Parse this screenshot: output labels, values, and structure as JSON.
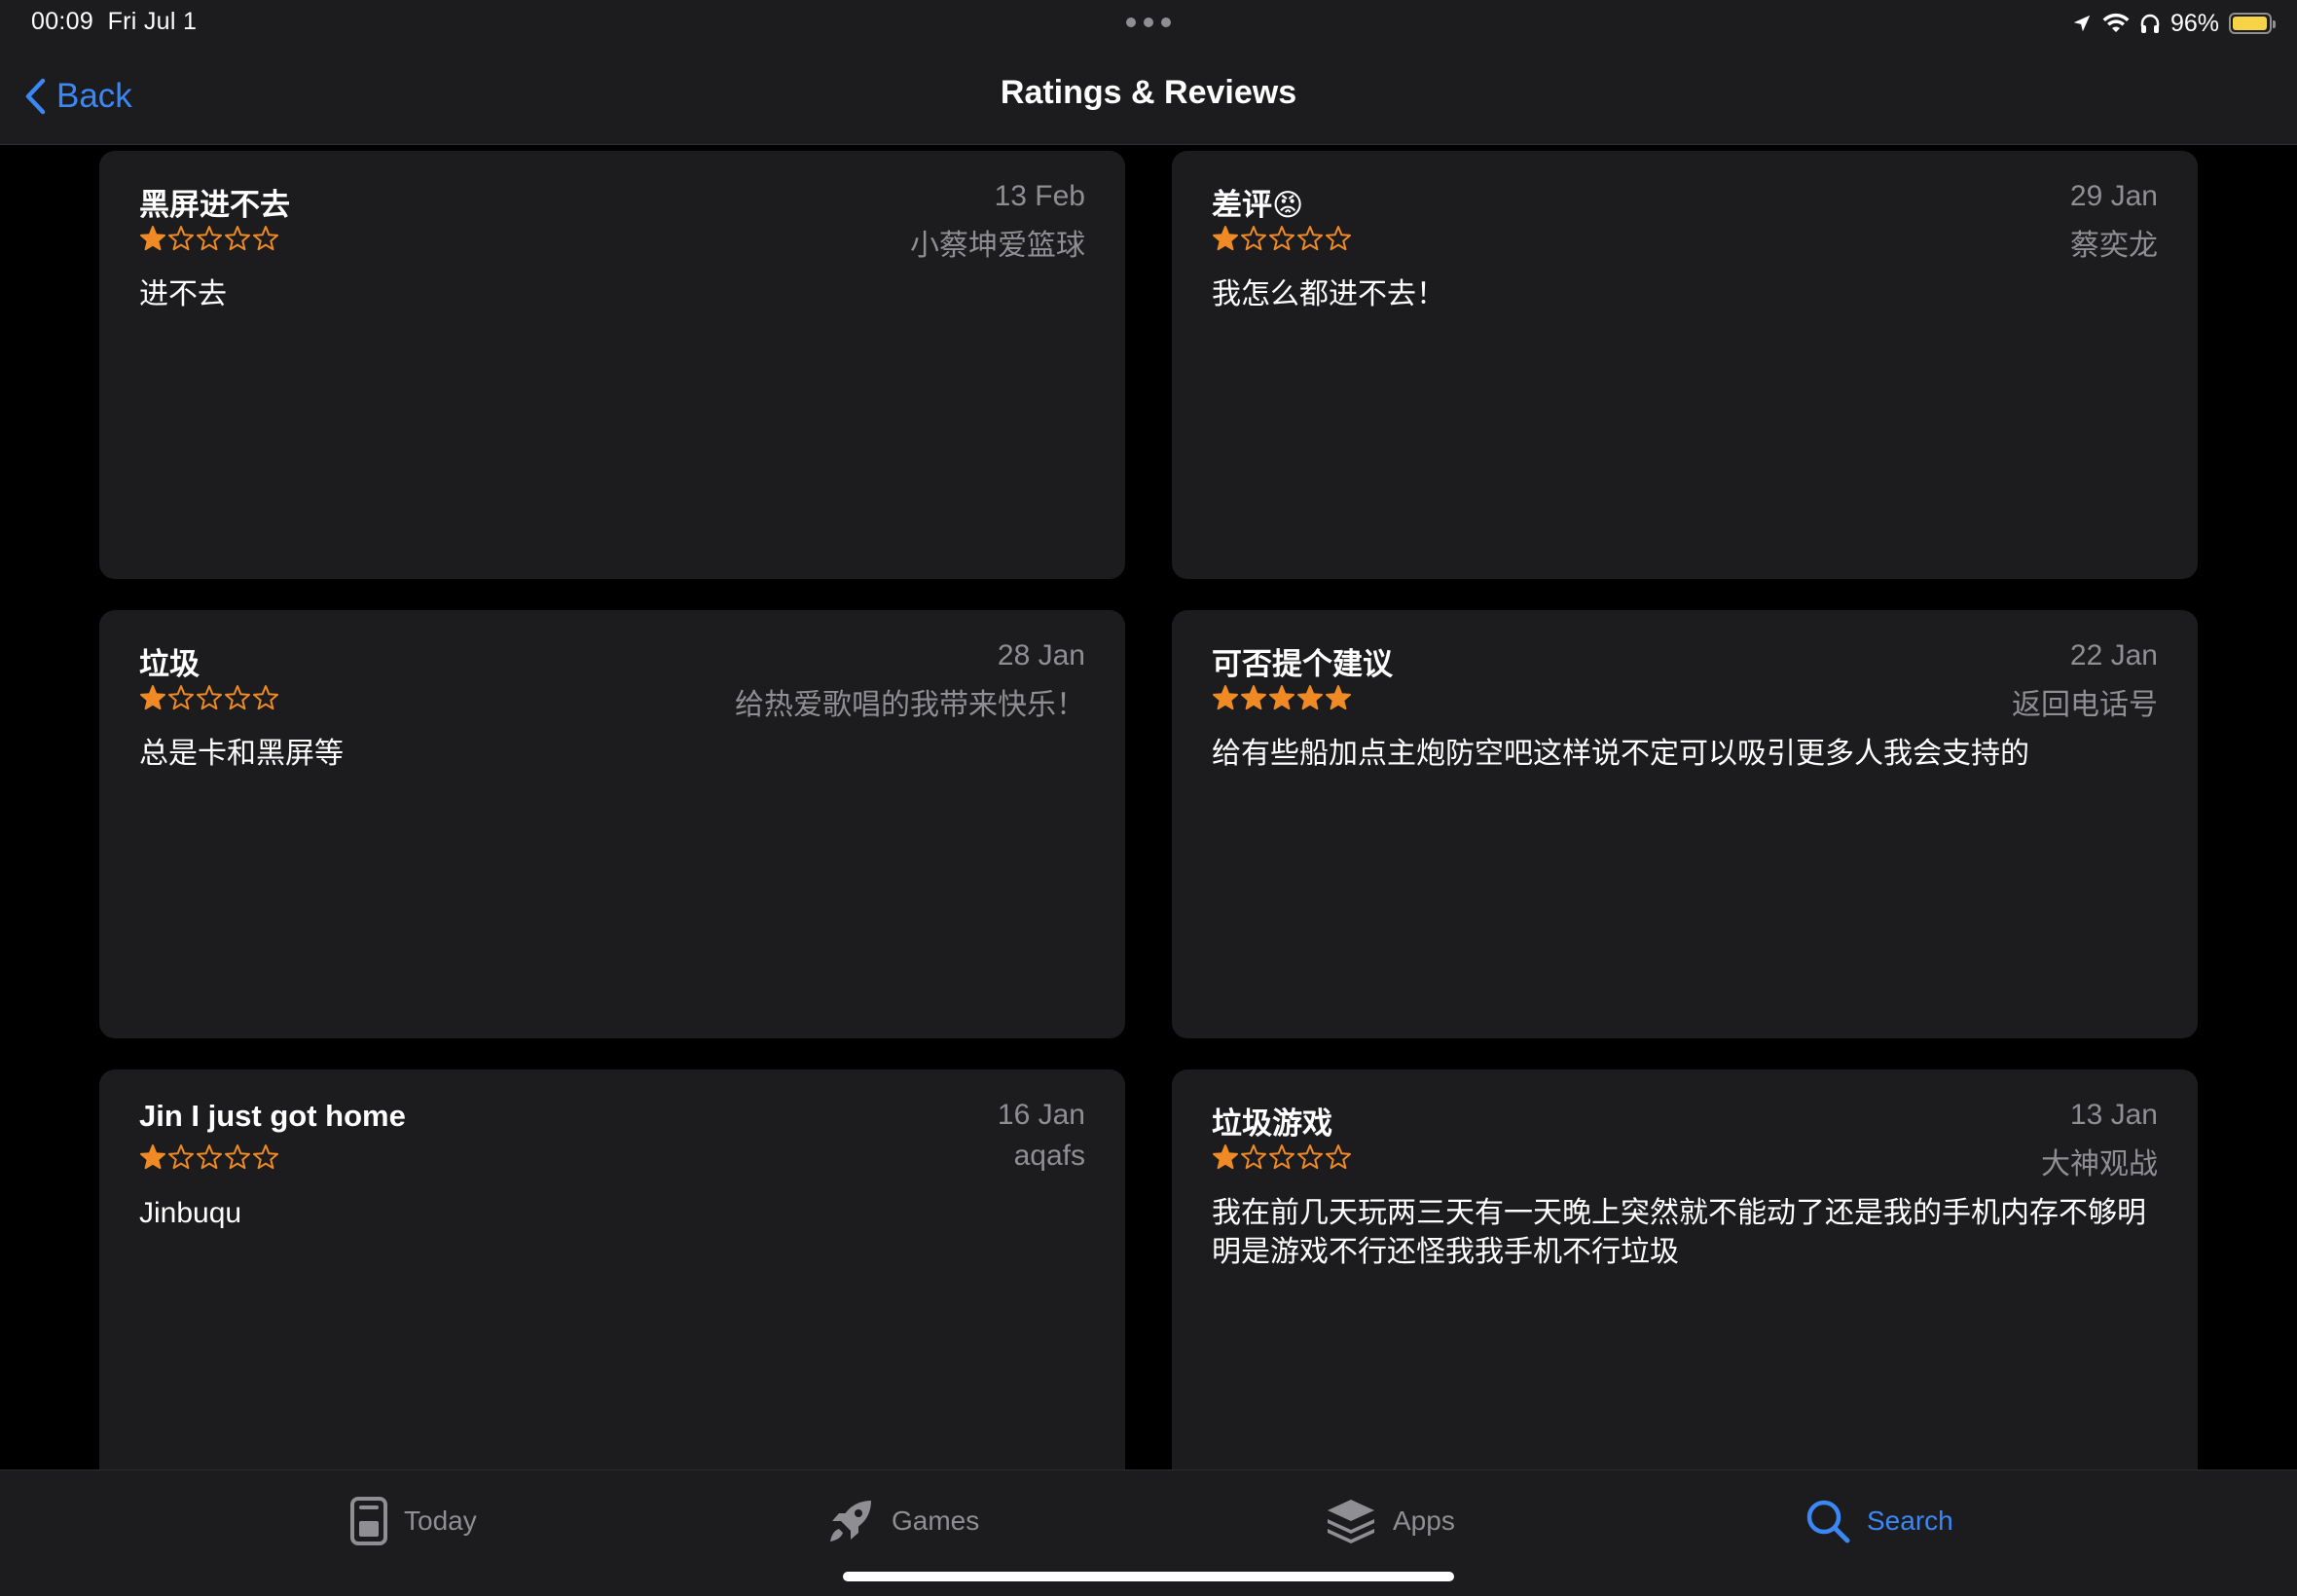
{
  "status_bar": {
    "time": "00:09",
    "date": "Fri Jul 1",
    "battery_percent": "96%",
    "battery_level": 0.96
  },
  "nav": {
    "back_label": "Back",
    "title": "Ratings & Reviews"
  },
  "colors": {
    "accent": "#3a87f5",
    "star": "#f08a24",
    "card_bg": "#1c1c1e",
    "secondary_text": "#8e8e93"
  },
  "reviews": [
    {
      "title": "黑屏进不去",
      "date": "13 Feb",
      "author": "小蔡坤爱篮球",
      "rating": 1,
      "body": "进不去"
    },
    {
      "title": "差评😡",
      "date": "29 Jan",
      "author": "蔡奕龙",
      "rating": 1,
      "body": "我怎么都进不去！"
    },
    {
      "title": "垃圾",
      "date": "28 Jan",
      "author": "给热爱歌唱的我带来快乐！",
      "rating": 1,
      "body": "总是卡和黑屏等"
    },
    {
      "title": "可否提个建议",
      "date": "22 Jan",
      "author": "返回电话号",
      "rating": 5,
      "body": "给有些船加点主炮防空吧这样说不定可以吸引更多人我会支持的"
    },
    {
      "title": "Jin I just got home",
      "date": "16 Jan",
      "author": "aqafs",
      "rating": 1,
      "body": "Jinbuqu"
    },
    {
      "title": "垃圾游戏",
      "date": "13 Jan",
      "author": "大神观战",
      "rating": 1,
      "body": "我在前几天玩两三天有一天晚上突然就不能动了还是我的手机内存不够明明是游戏不行还怪我我手机不行垃圾"
    }
  ],
  "tabs": [
    {
      "label": "Today",
      "icon": "today-icon",
      "active": false
    },
    {
      "label": "Games",
      "icon": "games-rocket-icon",
      "active": false
    },
    {
      "label": "Apps",
      "icon": "apps-stack-icon",
      "active": false
    },
    {
      "label": "Search",
      "icon": "search-icon",
      "active": true
    }
  ]
}
